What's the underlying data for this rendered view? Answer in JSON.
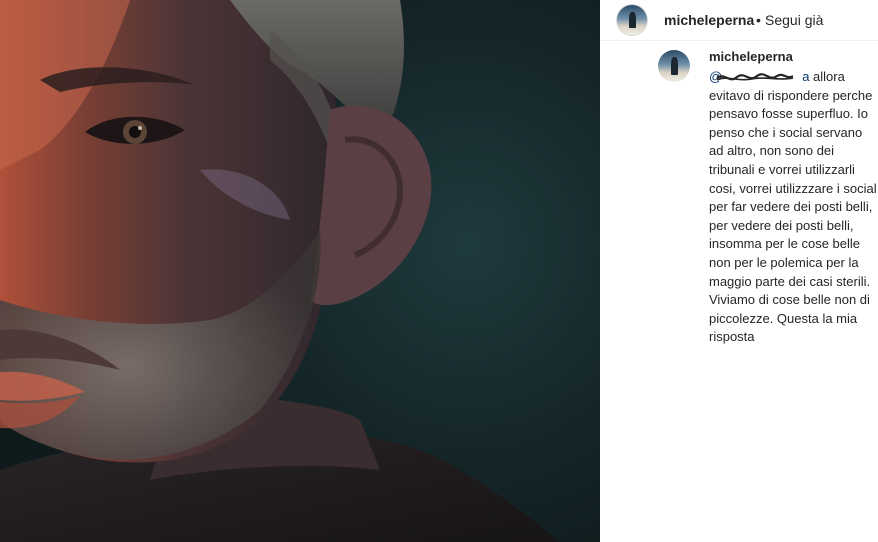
{
  "post": {
    "image_alt": "Close-up portrait photo",
    "header": {
      "username": "micheleperna",
      "separator": "•",
      "follow_label": "Segui già"
    }
  },
  "comment": {
    "username": "micheleperna",
    "mention": "@",
    "mention_suffix": "a",
    "text": " allora evitavo di rispondere perche pensavo fosse superfluo. Io penso che i social servano ad altro, non sono dei tribunali e vorrei utilizzarli cosi, vorrei utilizzzare i social per far vedere dei posti belli, per vedere dei posti belli, insomma per le cose belle non per le polemica per la maggio parte dei casi sterili. Viviamo di cose belle non di piccolezze. Questa la mia risposta"
  },
  "colors": {
    "text": "#262626",
    "mention": "#00376b",
    "divider": "#efefef",
    "photo_background": "#152629"
  }
}
